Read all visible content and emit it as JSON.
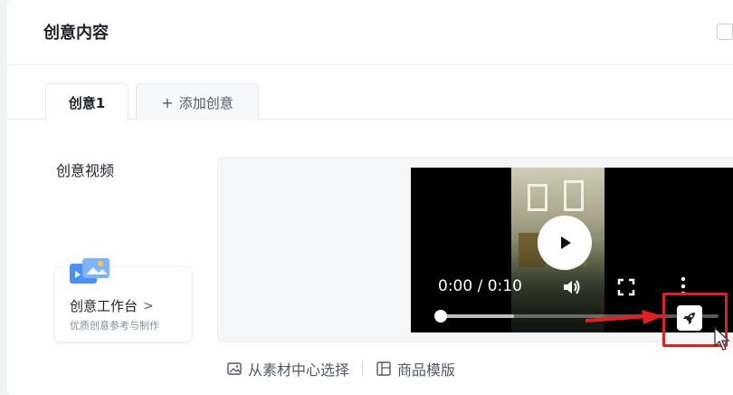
{
  "section": {
    "title": "创意内容"
  },
  "tabs": [
    {
      "label": "创意1",
      "active": true
    },
    {
      "label": "添加创意",
      "prefix": "+"
    }
  ],
  "field": {
    "label": "创意视频"
  },
  "workbench": {
    "title": "创意工作台",
    "chevron": ">",
    "subtitle": "优质创意参考与制作"
  },
  "player": {
    "time": "0:00 / 0:10",
    "progress_fraction": 0.0,
    "buffered_fraction": 0.27
  },
  "actions": [
    {
      "label": "从素材中心选择",
      "icon": "image-icon"
    },
    {
      "label": "商品模版",
      "icon": "template-icon"
    }
  ],
  "colors": {
    "highlight": "#e02020",
    "accent": "#4a8ef6"
  }
}
